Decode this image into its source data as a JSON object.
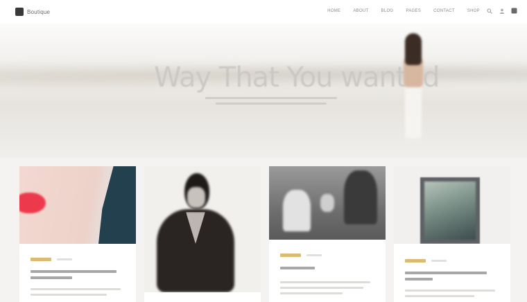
{
  "header": {
    "logo_text": "Boutique",
    "nav": [
      "Home",
      "About",
      "Blog",
      "Pages",
      "Contact",
      "Shop"
    ],
    "icons": [
      "search-icon",
      "user-icon",
      "cart-icon"
    ]
  },
  "hero": {
    "title": "Way That You wanted",
    "subtitle_lines": 2
  },
  "colors": {
    "accent_tag": "#d9bb73",
    "header_bg": "#ffffff",
    "page_bg": "#f4f3f1"
  },
  "cards": [
    {
      "image": "lips-closeup"
    },
    {
      "image": "woman-portrait-bw"
    },
    {
      "image": "couple-bw"
    },
    {
      "image": "framed-photo"
    }
  ]
}
